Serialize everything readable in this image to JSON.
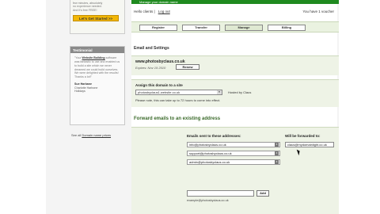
{
  "sidebar": {
    "promo_lines": [
      "few minutes, absolutely",
      "no experience needed.",
      "And it's free FREE!"
    ],
    "promo_button": "Let's Get Started >>",
    "testimonial_head": "Testimonial",
    "testimonial_quote_a": "\"Your ",
    "testimonial_quote_link": "Website Building",
    "testimonial_quote_b": " software was fantastic to use and enabled us to build a site which we never dreamed we could build ourselves. We were delighted with the results! Thanks a lot!\"",
    "author_name": "Sue Harbane",
    "author_company": "Charlotte Harbone",
    "author_extra": "Holidays",
    "see_link_a": "See all ",
    "see_link_b": "Domain name prices"
  },
  "header": {
    "bar_text": "Manage your domain name",
    "hello": "Hello clients |",
    "logout": "Log out",
    "voucher": "You have 1 voucher"
  },
  "tabs": [
    {
      "label": "Register"
    },
    {
      "label": "Transfer"
    },
    {
      "label": "Manage"
    },
    {
      "label": "Billing"
    }
  ],
  "email_settings": {
    "title": "Email and Settings",
    "domain": "www.photosbyclaus.co.uk",
    "expires": "Expires: Nov 19 2010",
    "renew": "Renew",
    "assign_label": "Assign this domain to a site",
    "assign_value": "photosbyclaus1.website.co.uk",
    "hosted": "Hosted by Claus",
    "note": "Please note, this can take up to 72 hours to come into effect."
  },
  "forward": {
    "title": "Forward emails to an existing address",
    "col_left": "Emails sent to these addresses:",
    "col_right": "Will be forwarded to:",
    "addresses": [
      {
        "email": "info@photosbyclaus.co.uk"
      },
      {
        "email": "support@photosbyclaus.co.uk"
      },
      {
        "email": "admin@photosbyclaus.co.uk"
      }
    ],
    "forward_to": "claus@mydomainlight.co.uk",
    "add_button": "Add",
    "example": "example@photosbyclaus.co.uk"
  }
}
